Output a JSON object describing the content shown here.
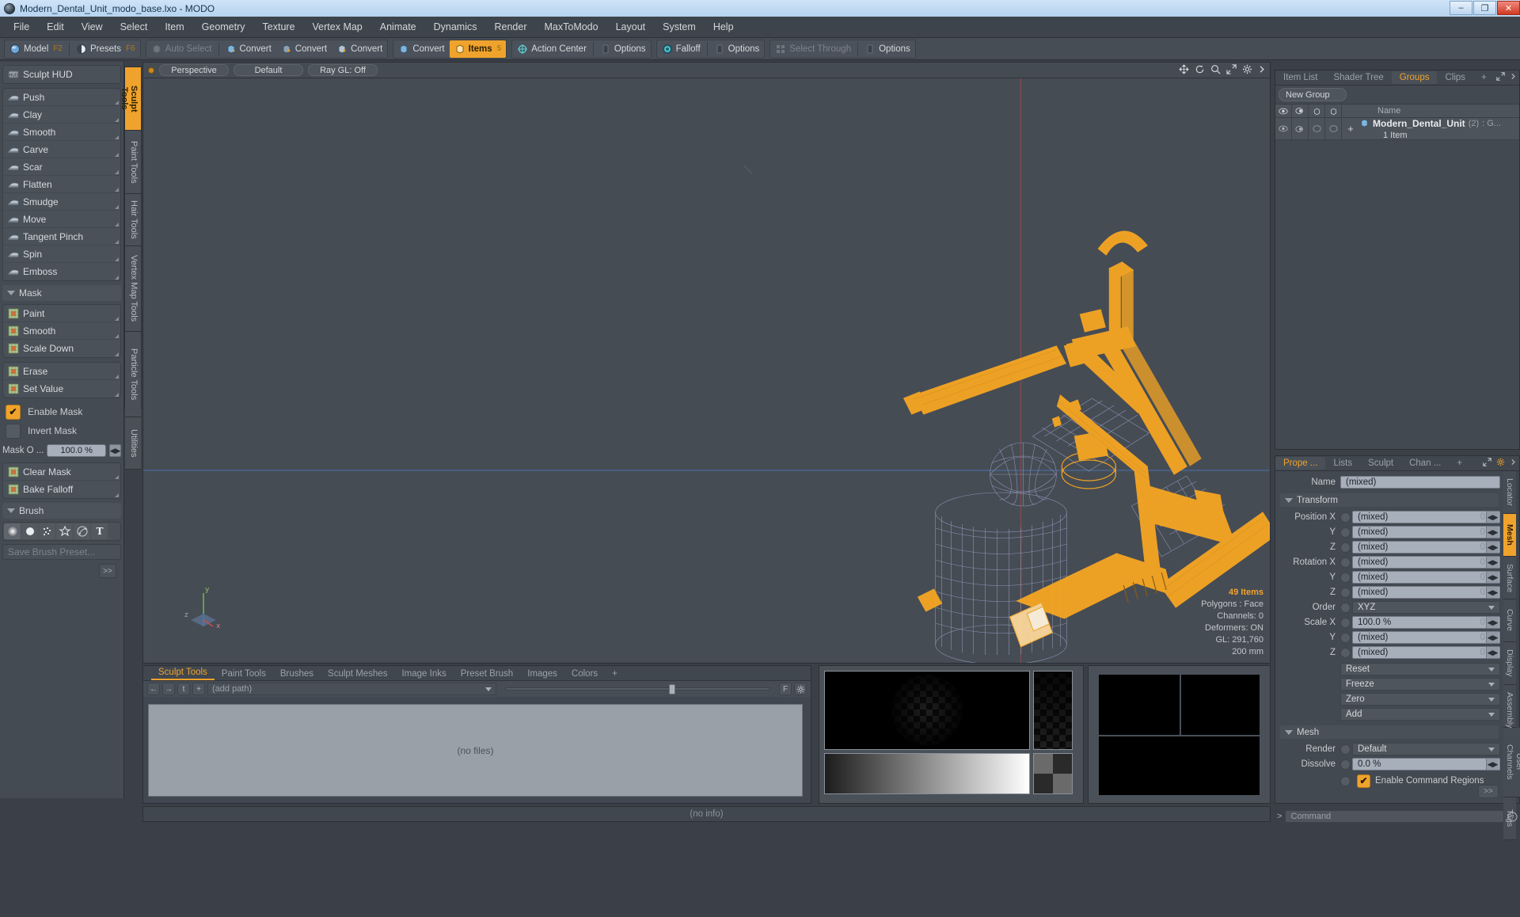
{
  "window": {
    "title": "Modern_Dental_Unit_modo_base.lxo - MODO",
    "minimize": "–",
    "maximize": "❐",
    "close": "✕"
  },
  "menubar": {
    "items": [
      "File",
      "Edit",
      "View",
      "Select",
      "Item",
      "Geometry",
      "Texture",
      "Vertex Map",
      "Animate",
      "Dynamics",
      "Render",
      "MaxToModo",
      "Layout",
      "System",
      "Help"
    ]
  },
  "toolbar": {
    "mode_model": "Model",
    "mode_model_key": "F2",
    "mode_presets": "Presets",
    "mode_presets_key": "F6",
    "auto_select": "Auto Select",
    "convert1": "Convert",
    "convert2": "Convert",
    "convert3": "Convert",
    "convert4": "Convert",
    "items": "Items",
    "items_num": "5",
    "action_center": "Action Center",
    "options1": "Options",
    "falloff": "Falloff",
    "options2": "Options",
    "select_through": "Select Through",
    "options3": "Options"
  },
  "left_vtabs": [
    {
      "label": "Sculpt Tools",
      "active": true
    },
    {
      "label": "Paint Tools",
      "active": false
    },
    {
      "label": "Hair Tools",
      "active": false
    },
    {
      "label": "Vertex Map Tools",
      "active": false
    },
    {
      "label": "Particle Tools",
      "active": false
    },
    {
      "label": "Utilities",
      "active": false
    }
  ],
  "left_panel": {
    "sculpt_hud": "Sculpt HUD",
    "tools": [
      "Push",
      "Clay",
      "Smooth",
      "Carve",
      "Scar",
      "Flatten",
      "Smudge",
      "Move",
      "Tangent Pinch",
      "Spin",
      "Emboss"
    ],
    "mask_section": "Mask",
    "mask_tools": [
      "Paint",
      "Smooth",
      "Scale Down"
    ],
    "mask_tools2": [
      "Erase",
      "Set Value"
    ],
    "enable_mask": "Enable Mask",
    "enable_mask_checked": true,
    "invert_mask": "Invert Mask",
    "invert_mask_checked": false,
    "mask_opacity_label": "Mask O  ...",
    "mask_opacity_value": "100.0 %",
    "mask_tools3": [
      "Clear Mask",
      "Bake Falloff"
    ],
    "brush_section": "Brush",
    "brush_icons": [
      "soft-brush-icon",
      "hard-brush-icon",
      "noise-brush-icon",
      "star-brush-icon",
      "procedural-brush-icon",
      "text-brush-icon"
    ],
    "save_brush_preset": "Save Brush Preset...",
    "more_button": ">>"
  },
  "viewport": {
    "projection": "Perspective",
    "shading": "Default",
    "raygl": "Ray GL: Off",
    "icons": [
      "move-icon",
      "rotate-icon",
      "zoom-icon",
      "maximize-icon",
      "gear-icon",
      "chevron-right-icon"
    ],
    "info": {
      "items": "49 Items",
      "polygons": "Polygons : Face",
      "channels": "Channels: 0",
      "deformers": "Deformers: ON",
      "gl": "GL: 291,760",
      "grid": "200 mm"
    },
    "axis": {
      "x": "x",
      "y": "y",
      "z": "z"
    }
  },
  "bottom_panel": {
    "tabs": [
      "Sculpt Tools",
      "Paint Tools",
      "Brushes",
      "Sculpt Meshes",
      "Image Inks",
      "Preset Brush",
      "Images",
      "Colors"
    ],
    "active_tab": "Sculpt Tools",
    "add_tab": "+",
    "nav": {
      "back": "←",
      "forward": "→",
      "up": "t",
      "add": "+"
    },
    "path_placeholder": "(add path)",
    "filter_letter": "F",
    "files_empty": "(no files)",
    "no_info": "(no info)"
  },
  "groups_panel": {
    "tabs": [
      "Item List",
      "Shader Tree",
      "Groups",
      "Clips"
    ],
    "active_tab": "Groups",
    "add_tab": "+",
    "new_group_button": "New Group",
    "columns": [
      "eye-icon",
      "render-icon",
      "lock-icon",
      "select-icon",
      "Name"
    ],
    "name_header": "Name",
    "rows": [
      {
        "expander": "+",
        "name": "Modern_Dental_Unit",
        "count": "(2)",
        "suffix": ": G...",
        "sub": "1 Item"
      }
    ]
  },
  "properties_panel": {
    "tabs": [
      "Prope ...",
      "Lists",
      "Sculpt",
      "Chan ..."
    ],
    "active_tab": "Prope ...",
    "add_tab": "+",
    "name_label": "Name",
    "name_value": "(mixed)",
    "transform_section": "Transform",
    "transform_rows": [
      {
        "label": "Position X",
        "value": "(mixed)",
        "type": "field"
      },
      {
        "label": "Y",
        "value": "(mixed)",
        "type": "field"
      },
      {
        "label": "Z",
        "value": "(mixed)",
        "type": "field"
      },
      {
        "label": "Rotation X",
        "value": "(mixed)",
        "type": "field"
      },
      {
        "label": "Y",
        "value": "(mixed)",
        "type": "field"
      },
      {
        "label": "Z",
        "value": "(mixed)",
        "type": "field"
      },
      {
        "label": "Order",
        "value": "XYZ",
        "type": "drop"
      },
      {
        "label": "Scale X",
        "value": "100.0 %",
        "type": "field"
      },
      {
        "label": "Y",
        "value": "(mixed)",
        "type": "field"
      },
      {
        "label": "Z",
        "value": "(mixed)",
        "type": "field"
      }
    ],
    "action_drops": [
      "Reset",
      "Freeze",
      "Zero",
      "Add"
    ],
    "mesh_section": "Mesh",
    "render_label": "Render",
    "render_value": "Default",
    "dissolve_label": "Dissolve",
    "dissolve_value": "0.0 %",
    "enable_command_regions": "Enable Command Regions",
    "enable_command_regions_checked": true,
    "more_button": ">>",
    "vtabs": [
      {
        "label": "Locator",
        "active": false
      },
      {
        "label": "Mesh",
        "active": true
      },
      {
        "label": "Surface",
        "active": false
      },
      {
        "label": "Curve",
        "active": false
      },
      {
        "label": "Display",
        "active": false
      },
      {
        "label": "Assembly",
        "active": false
      },
      {
        "label": "User Channels",
        "active": false
      },
      {
        "label": "Tags",
        "active": false
      }
    ]
  },
  "command_bar": {
    "prefix": ">",
    "placeholder": "Command",
    "help_icon": "help-icon"
  },
  "colors": {
    "accent": "#f0a32c",
    "panel": "#454b53",
    "viewport_bg": "#464c54",
    "wire_selected": "#f5a623",
    "wire_unselected": "#8f96b8",
    "axis_x": "#a04040",
    "axis_z": "#4060a0"
  }
}
